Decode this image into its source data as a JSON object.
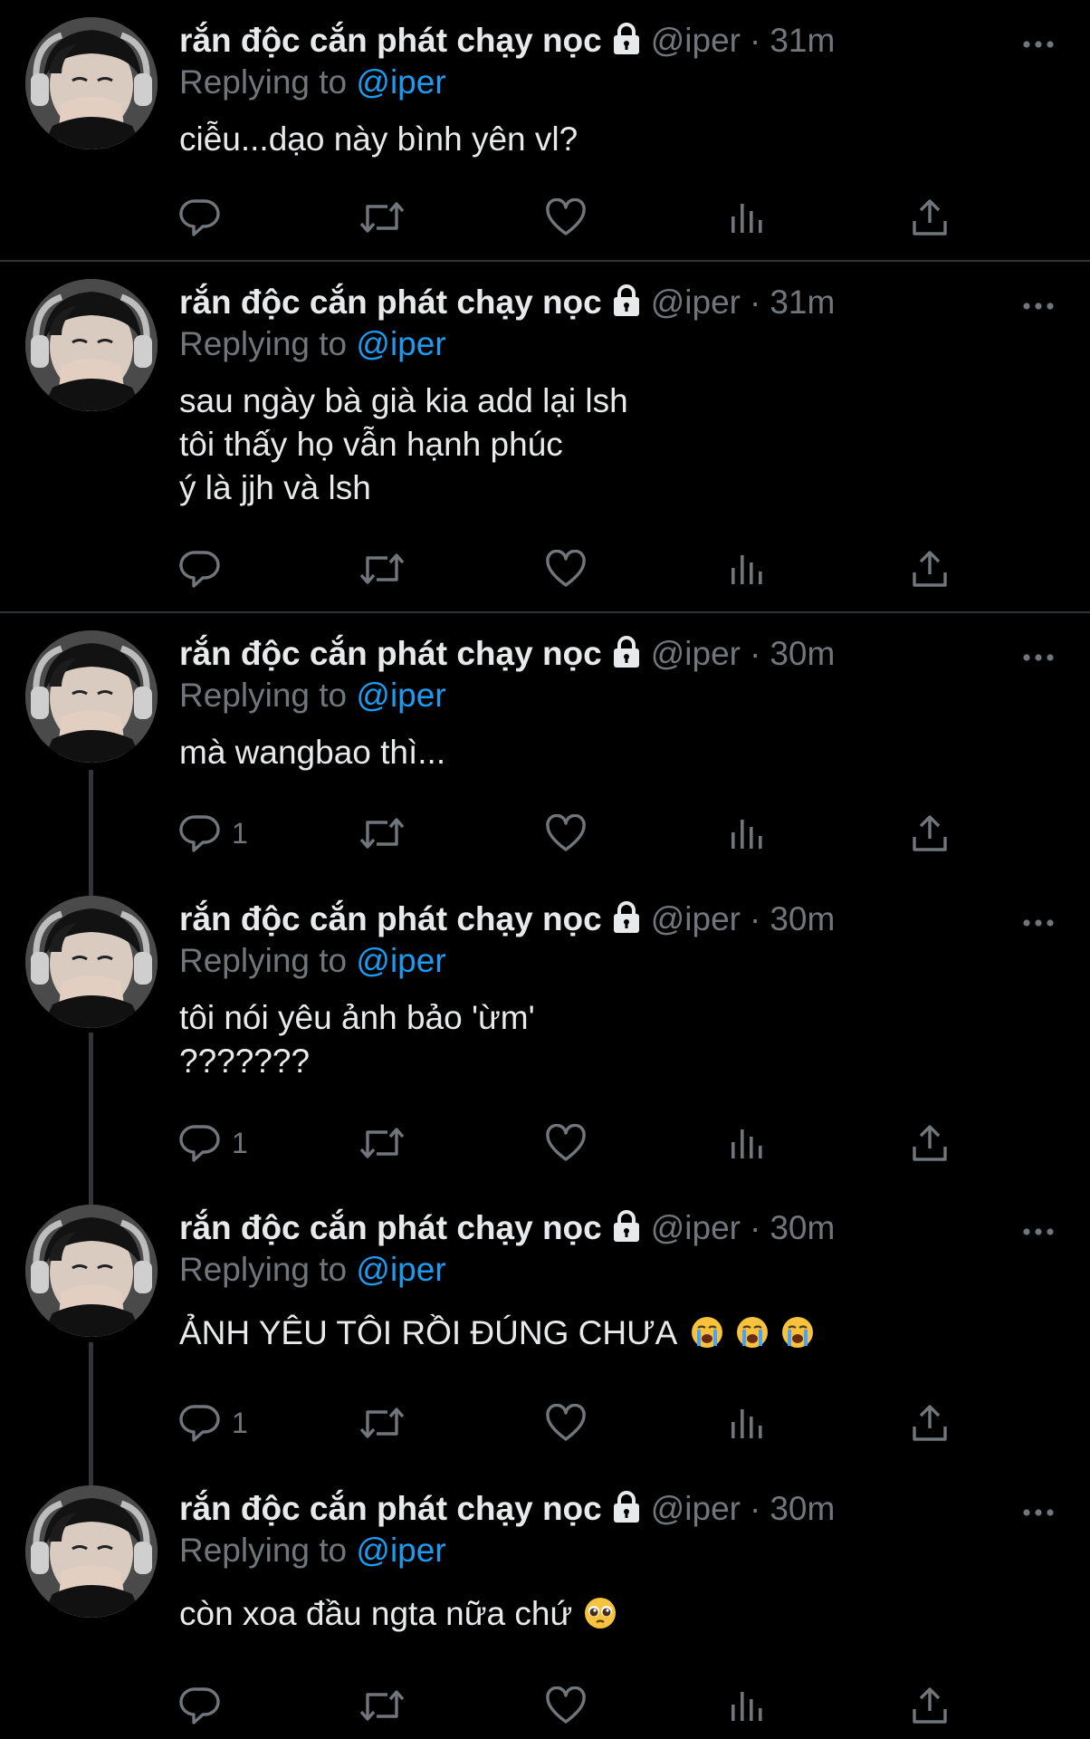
{
  "author": {
    "name": "rắn độc cắn phát chạy nọc",
    "handle": "@iper"
  },
  "colors": {
    "background": "#000000",
    "text": "#e7e9ea",
    "secondary": "#71767b",
    "link": "#1d9bf0",
    "divider": "#2f3336"
  },
  "icons": {
    "lock": "lock-icon",
    "more": "more-icon",
    "reply": "reply-icon",
    "retweet": "retweet-icon",
    "like": "like-icon",
    "views": "views-icon",
    "share": "share-icon"
  },
  "tweets": [
    {
      "time": "31m",
      "separator": "·",
      "replying_prefix": "Replying to",
      "replying_to": "@iper",
      "lines": [
        "ciễu...dạo này bình yên vl?"
      ],
      "reply_count": ""
    },
    {
      "time": "31m",
      "separator": "·",
      "replying_prefix": "Replying to",
      "replying_to": "@iper",
      "lines": [
        "sau ngày bà già kia add lại lsh",
        "tôi thấy họ vẫn hạnh phúc",
        "ý là jjh và lsh"
      ],
      "reply_count": ""
    },
    {
      "time": "30m",
      "separator": "·",
      "replying_prefix": "Replying to",
      "replying_to": "@iper",
      "lines": [
        "mà wangbao thì..."
      ],
      "reply_count": "1"
    },
    {
      "time": "30m",
      "separator": "·",
      "replying_prefix": "Replying to",
      "replying_to": "@iper",
      "lines": [
        "tôi nói yêu ảnh bảo 'ừm'",
        "???????"
      ],
      "reply_count": "1"
    },
    {
      "time": "30m",
      "separator": "·",
      "replying_prefix": "Replying to",
      "replying_to": "@iper",
      "lines": [
        "ẢNH YÊU TÔI RỒI ĐÚNG CHƯA"
      ],
      "emoji_after": [
        "loudly-crying-face",
        "loudly-crying-face",
        "loudly-crying-face"
      ],
      "reply_count": "1"
    },
    {
      "time": "30m",
      "separator": "·",
      "replying_prefix": "Replying to",
      "replying_to": "@iper",
      "lines": [
        "còn xoa đầu ngta nữa chứ"
      ],
      "emoji_after": [
        "pleading-face"
      ],
      "reply_count": ""
    }
  ]
}
